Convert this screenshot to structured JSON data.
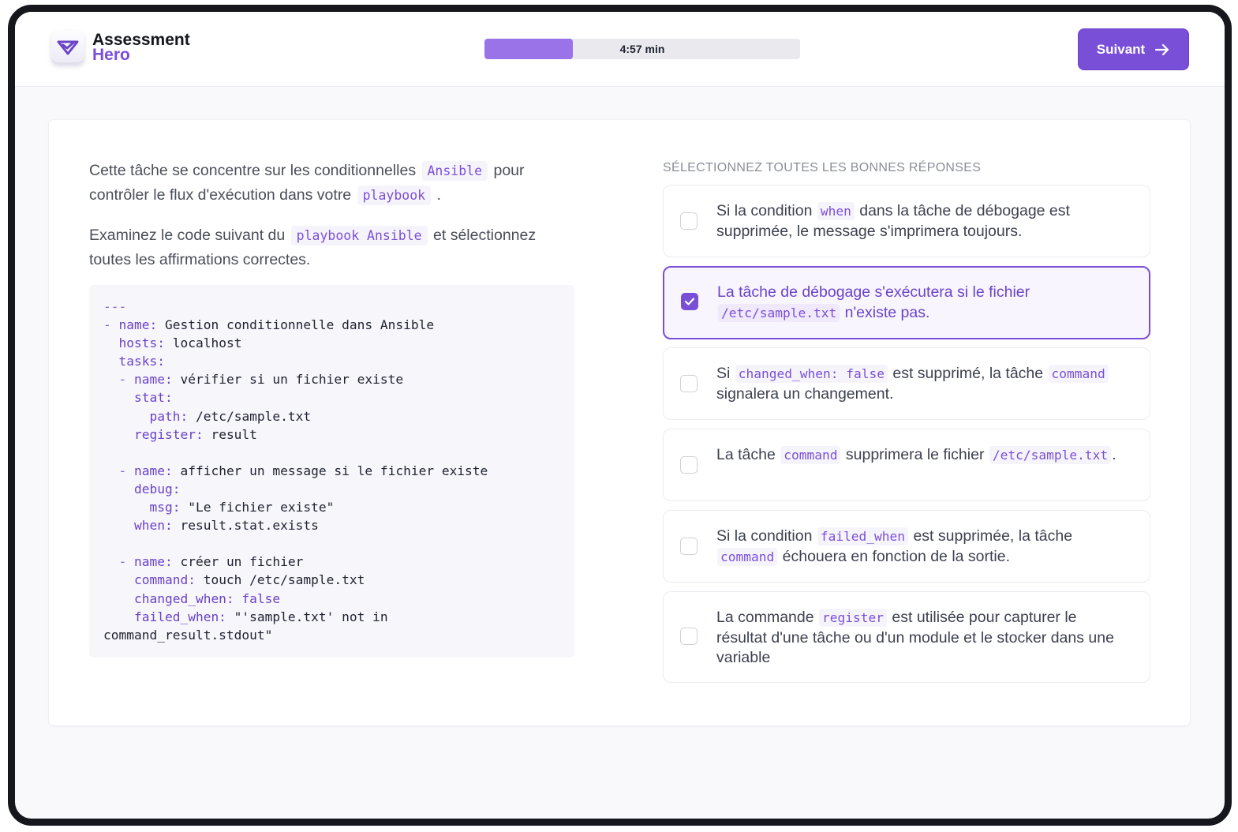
{
  "app": {
    "logo_line1": "Assessment",
    "logo_line2": "Hero"
  },
  "timer": {
    "label": "4:57 min",
    "progress": 0.28
  },
  "next_button": {
    "label": "Suivant"
  },
  "question": {
    "p1_a": "Cette tâche se concentre sur les conditionnelles",
    "p1_code1": "Ansible",
    "p1_b": "pour contrôler le flux d'exécution dans votre",
    "p1_code2": "playbook",
    "p1_c": ".",
    "p2_a": "Examinez le code suivant du",
    "p2_code": "playbook Ansible",
    "p2_b": "et sélectionnez toutes les affirmations correctes."
  },
  "code_lines": [
    [
      {
        "t": "---",
        "c": "d"
      }
    ],
    [
      {
        "t": "- ",
        "c": "d"
      },
      {
        "t": "name:",
        "c": "k"
      },
      {
        "t": " Gestion conditionnelle dans Ansible",
        "c": ""
      }
    ],
    [
      {
        "t": "  ",
        "c": ""
      },
      {
        "t": "hosts:",
        "c": "k"
      },
      {
        "t": " localhost",
        "c": ""
      }
    ],
    [
      {
        "t": "  ",
        "c": ""
      },
      {
        "t": "tasks:",
        "c": "k"
      }
    ],
    [
      {
        "t": "  - ",
        "c": "d"
      },
      {
        "t": "name:",
        "c": "k"
      },
      {
        "t": " vérifier si un fichier existe",
        "c": ""
      }
    ],
    [
      {
        "t": "    ",
        "c": ""
      },
      {
        "t": "stat:",
        "c": "k"
      }
    ],
    [
      {
        "t": "      ",
        "c": ""
      },
      {
        "t": "path:",
        "c": "k"
      },
      {
        "t": " /etc/sample.txt",
        "c": ""
      }
    ],
    [
      {
        "t": "    ",
        "c": ""
      },
      {
        "t": "register:",
        "c": "k"
      },
      {
        "t": " result",
        "c": ""
      }
    ],
    [
      {
        "t": "",
        "c": ""
      }
    ],
    [
      {
        "t": "  - ",
        "c": "d"
      },
      {
        "t": "name:",
        "c": "k"
      },
      {
        "t": " afficher un message si le fichier existe",
        "c": ""
      }
    ],
    [
      {
        "t": "    ",
        "c": ""
      },
      {
        "t": "debug:",
        "c": "k"
      }
    ],
    [
      {
        "t": "      ",
        "c": ""
      },
      {
        "t": "msg:",
        "c": "k"
      },
      {
        "t": " \"Le fichier existe\"",
        "c": ""
      }
    ],
    [
      {
        "t": "    ",
        "c": ""
      },
      {
        "t": "when:",
        "c": "k"
      },
      {
        "t": " result.stat.exists",
        "c": ""
      }
    ],
    [
      {
        "t": "",
        "c": ""
      }
    ],
    [
      {
        "t": "  - ",
        "c": "d"
      },
      {
        "t": "name:",
        "c": "k"
      },
      {
        "t": " créer un fichier",
        "c": ""
      }
    ],
    [
      {
        "t": "    ",
        "c": ""
      },
      {
        "t": "command:",
        "c": "k"
      },
      {
        "t": " touch /etc/sample.txt",
        "c": ""
      }
    ],
    [
      {
        "t": "    ",
        "c": ""
      },
      {
        "t": "changed_when:",
        "c": "k"
      },
      {
        "t": " ",
        "c": ""
      },
      {
        "t": "false",
        "c": "k"
      }
    ],
    [
      {
        "t": "    ",
        "c": ""
      },
      {
        "t": "failed_when:",
        "c": "k"
      },
      {
        "t": " \"'sample.txt' not in",
        "c": ""
      }
    ],
    [
      {
        "t": "command_result.stdout\"",
        "c": ""
      }
    ]
  ],
  "answers": {
    "instruction": "Sélectionnez toutes les bonnes réponses",
    "options": [
      {
        "selected": false,
        "parts": [
          {
            "t": "Si la condition ",
            "code": false
          },
          {
            "t": "when",
            "code": true
          },
          {
            "t": " dans la tâche de débogage est supprimée, le message s'imprimera toujours.",
            "code": false
          }
        ]
      },
      {
        "selected": true,
        "parts": [
          {
            "t": "La tâche de débogage s'exécutera si le fichier ",
            "code": false
          },
          {
            "t": "/etc/sample.txt",
            "code": true
          },
          {
            "t": " n'existe pas.",
            "code": false
          }
        ]
      },
      {
        "selected": false,
        "parts": [
          {
            "t": "Si ",
            "code": false
          },
          {
            "t": "changed_when: false",
            "code": true
          },
          {
            "t": " est supprimé, la tâche ",
            "code": false
          },
          {
            "t": "command",
            "code": true
          },
          {
            "t": " signalera un changement.",
            "code": false
          }
        ]
      },
      {
        "selected": false,
        "parts": [
          {
            "t": "La tâche ",
            "code": false
          },
          {
            "t": "command",
            "code": true
          },
          {
            "t": " supprimera le fichier ",
            "code": false
          },
          {
            "t": "/etc/sample.txt",
            "code": true
          },
          {
            "t": ".",
            "code": false
          }
        ]
      },
      {
        "selected": false,
        "parts": [
          {
            "t": "Si la condition ",
            "code": false
          },
          {
            "t": "failed_when",
            "code": true
          },
          {
            "t": " est supprimée, la tâche ",
            "code": false
          },
          {
            "t": "command",
            "code": true
          },
          {
            "t": " échouera en fonction de la sortie.",
            "code": false
          }
        ]
      },
      {
        "selected": false,
        "parts": [
          {
            "t": "La commande ",
            "code": false
          },
          {
            "t": "register",
            "code": true
          },
          {
            "t": " est utilisée pour capturer le résultat d'une tâche ou d'un module et le stocker dans une variable",
            "code": false
          }
        ]
      }
    ]
  },
  "colors": {
    "accent": "#7a4fd8",
    "accent_light": "#9a73e8",
    "code_text": "#7b4fd9"
  },
  "icons": {
    "logo": "check-shield-icon",
    "next": "arrow-right-icon",
    "checked": "check-icon"
  }
}
